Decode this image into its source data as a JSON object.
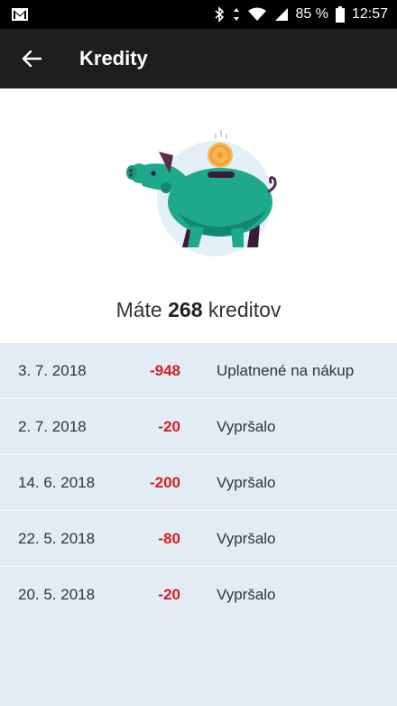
{
  "status_bar": {
    "battery": "85 %",
    "time": "12:57"
  },
  "app_bar": {
    "title": "Kredity"
  },
  "summary": {
    "prefix": "Máte",
    "amount": "268",
    "suffix": "kreditov"
  },
  "history": [
    {
      "date": "3. 7. 2018",
      "amount": "-948",
      "description": "Uplatnené na nákup"
    },
    {
      "date": "2. 7. 2018",
      "amount": "-20",
      "description": "Vypršalo"
    },
    {
      "date": "14. 6. 2018",
      "amount": "-200",
      "description": "Vypršalo"
    },
    {
      "date": "22. 5. 2018",
      "amount": "-80",
      "description": "Vypršalo"
    },
    {
      "date": "20. 5. 2018",
      "amount": "-20",
      "description": "Vypršalo"
    }
  ],
  "colors": {
    "app_bar": "#1e1e1e",
    "negative_amount": "#d91c1c",
    "list_background": "#e1ecf5",
    "pig": "#1fa98c"
  }
}
